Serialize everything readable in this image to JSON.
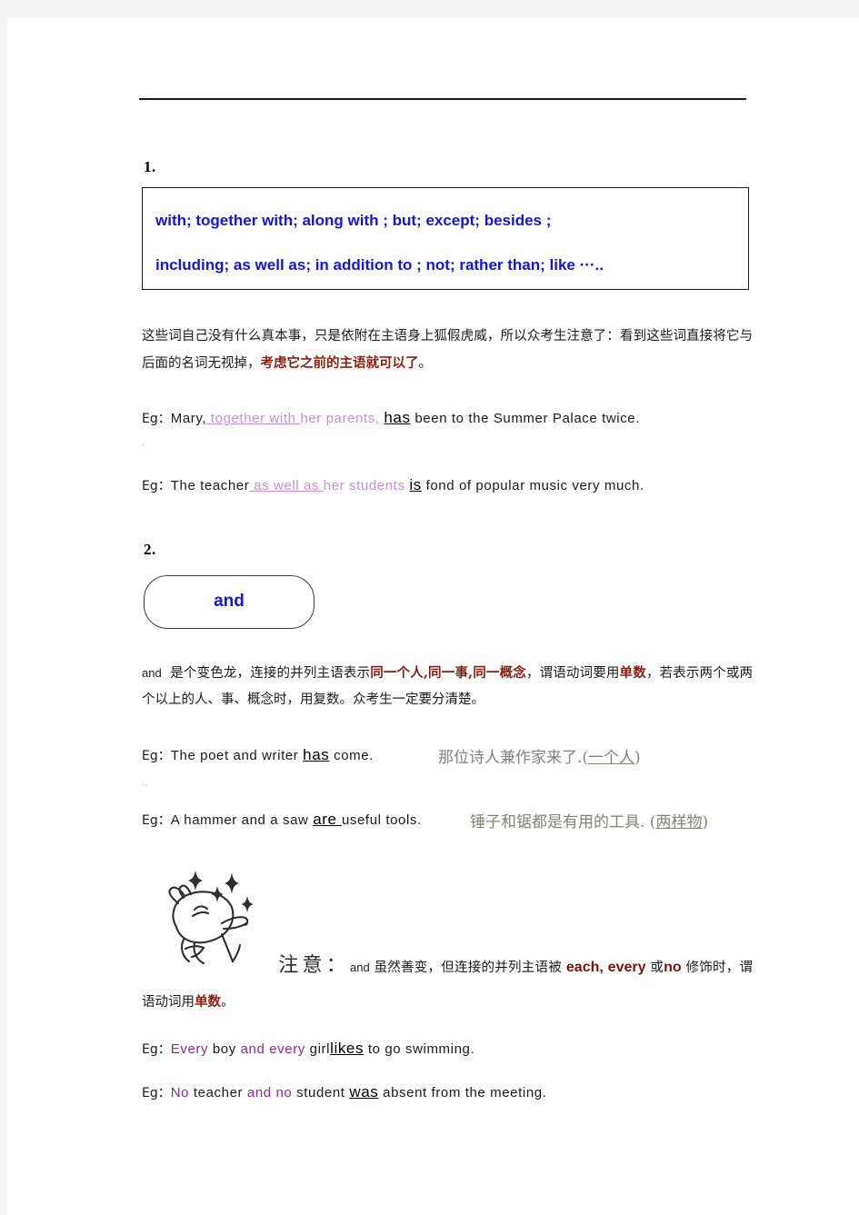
{
  "page": {
    "background": "#f4f4f4",
    "paper": "#ffffff"
  },
  "colors": {
    "blue": "#1414e6",
    "red_emphasis": "#8a1f10",
    "violet": "#c78fd6",
    "purple": "#8e2a8e",
    "gloss_gray": "#83837a",
    "rule": "#1a1a1a"
  },
  "sections": [
    {
      "number": "1.",
      "box": {
        "type": "rectangle",
        "line1": "with;     together  with;     along  with ;     but;  except;     besides ;",
        "line2": "including;     as well as;    in addition to ; not;    rather than;    like ···..",
        "words_line1": [
          "with;",
          "together",
          "with;",
          "along",
          "with ;",
          "but;",
          "except;",
          "besides ;"
        ],
        "words_line2": [
          "including;",
          "as well as;",
          "in addition to ;",
          "not;",
          "rather than;",
          "like ···.."
        ]
      },
      "paragraph": {
        "part1": "这些词自己没有什么真本事，只是依附在主语身上狐假虎威，所以众考生注意了：看到这些词直接将它与后面的名词无视掉，",
        "emphasis": "考虑它之前的主语就可以了",
        "part2": "。"
      },
      "examples": [
        {
          "label": "Eg：",
          "pre": "Mary,",
          "violet_underline": " together with ",
          "violet": "her parents,",
          "verb": "has",
          "post": " been to the Summer Palace twice."
        },
        {
          "label": "Eg：",
          "pre": "The teacher",
          "violet_underline": " as well as ",
          "violet": "her students",
          "verb": "is",
          "post": " fond of popular music very much."
        }
      ]
    },
    {
      "number": "2.",
      "box": {
        "type": "rounded",
        "label": "and"
      },
      "paragraph": {
        "en_lead": "and",
        "part1": "是个变色龙，连接的并列主语表示",
        "emphasis1": "同一个人,同一事,同一概念",
        "part2": "，谓语动词要用",
        "emphasis2": "单数",
        "part3": "，若表示两个或两个以上的人、事、概念时，用复数。众考生一定要分清楚。"
      },
      "examples": [
        {
          "label": "Eg：",
          "pre": "The poet and writer",
          "verb": "has",
          "post": " come.",
          "gloss_pre": "那位诗人兼作家来了.(",
          "gloss_underline": "一个人",
          "gloss_post": ")"
        },
        {
          "label": "Eg：",
          "pre": "A hammer and a saw",
          "verb": "are ",
          "post": "useful tools.",
          "gloss_pre": "锤子和锯都是有用的工具. (",
          "gloss_underline": "两样物",
          "gloss_post": ")"
        }
      ],
      "note": {
        "doodle": "bunny-sparkle-doodle",
        "heading": "注意：",
        "en_lead": "and",
        "part1": "虽然善变，但连接的并列主语被",
        "kw1": "each,",
        "kw2": "every",
        "mid": "或",
        "kw3": "no",
        "part2": "修饰时，谓语动词用",
        "emphasis": "单数",
        "part3": "。"
      },
      "note_examples": [
        {
          "label": "Eg：",
          "w1": "Every",
          "w2": " boy ",
          "w3": "and",
          "w4": " every ",
          "w5": "girl",
          "verb": "likes",
          "post": " to go swimming."
        },
        {
          "label": "Eg：",
          "w1": "No",
          "w2": " teacher ",
          "w3": "and",
          "w4": " no ",
          "w5": "student",
          "verb": "was",
          "post": " absent from the meeting."
        }
      ]
    }
  ],
  "specks": {
    "one": "ˈ",
    "two": "··"
  }
}
